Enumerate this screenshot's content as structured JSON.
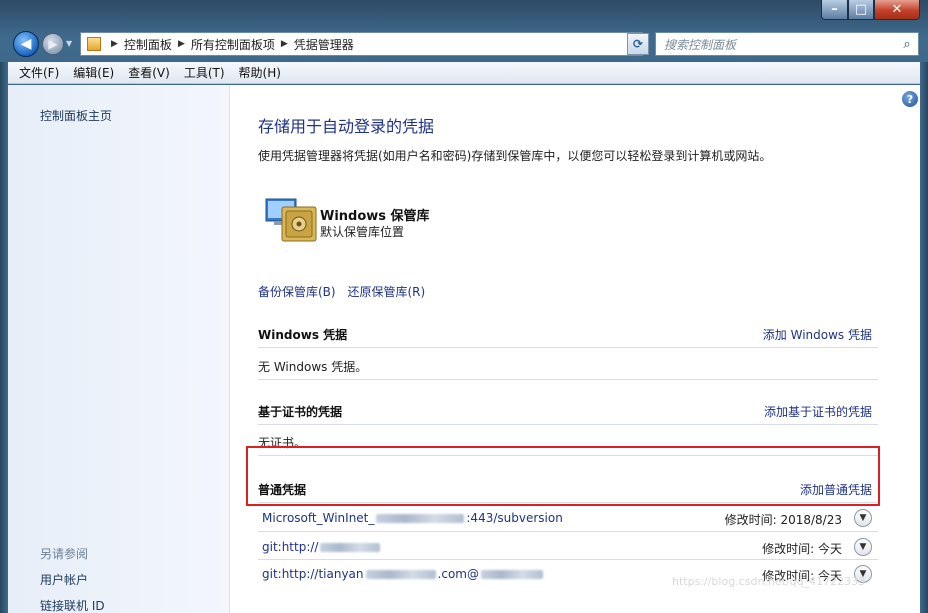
{
  "window": {
    "controls": {
      "minimize": "–",
      "maximize": "□",
      "close": "✕"
    }
  },
  "nav": {
    "back_icon": "arrow-left-icon",
    "forward_icon": "arrow-right-icon",
    "breadcrumb": [
      "控制面板",
      "所有控制面板项",
      "凭据管理器"
    ],
    "search_placeholder": "搜索控制面板"
  },
  "menubar": {
    "items": [
      "文件(F)",
      "编辑(E)",
      "查看(V)",
      "工具(T)",
      "帮助(H)"
    ]
  },
  "sidebar": {
    "home": "控制面板主页",
    "see_also": "另请参阅",
    "links": [
      "用户帐户",
      "链接联机 ID"
    ]
  },
  "main": {
    "title": "存储用于自动登录的凭据",
    "description": "使用凭据管理器将凭据(如用户名和密码)存储到保管库中，以便您可以轻松登录到计算机或网站。",
    "vault": {
      "title": "Windows 保管库",
      "subtitle": "默认保管库位置"
    },
    "backup_link": "备份保管库(B)",
    "restore_link": "还原保管库(R)",
    "sections": {
      "windows": {
        "title": "Windows 凭据",
        "add": "添加 Windows 凭据",
        "empty": "无 Windows 凭据。"
      },
      "certificate": {
        "title": "基于证书的凭据",
        "add": "添加基于证书的凭据",
        "empty": "无证书。"
      },
      "generic": {
        "title": "普通凭据",
        "add": "添加普通凭据"
      }
    },
    "credentials": [
      {
        "name_prefix": "Microsoft_WinInet_",
        "name_suffix": ":443/subversion",
        "modified": "修改时间:  2018/8/23"
      },
      {
        "name_prefix": "git:http://",
        "name_suffix": "",
        "modified": "修改时间:  今天"
      },
      {
        "name_prefix": "git:http://tianyan",
        "name_middle": ".com@",
        "name_suffix": "",
        "modified": "修改时间:  今天"
      }
    ]
  },
  "colors": {
    "link": "#1e3287",
    "highlight_box": "#e02020"
  },
  "watermark": "https://blog.csdn.net/qq_41722333"
}
